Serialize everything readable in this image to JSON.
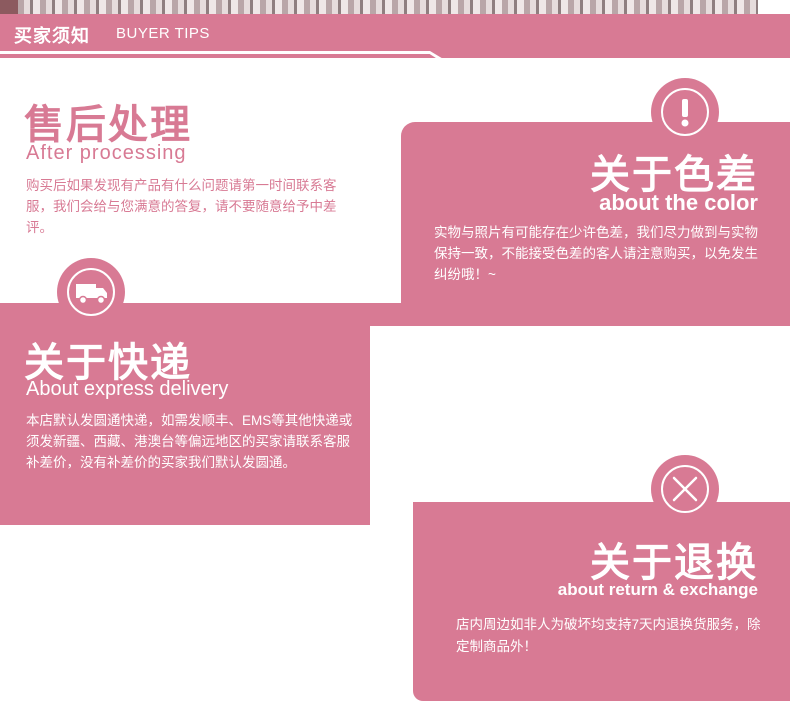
{
  "header": {
    "title_cn": "买家须知",
    "title_en": "BUYER TIPS"
  },
  "after": {
    "title_cn": "售后处理",
    "title_en": "After processing",
    "body": "购买后如果发现有产品有什么问题请第一时间联系客服，我们会给与您满意的答复，请不要随意给予中差评。"
  },
  "color": {
    "title_cn": "关于色差",
    "title_en": "about the color",
    "body": "实物与照片有可能存在少许色差，我们尽力做到与实物保持一致，不能接受色差的客人请注意购买，以免发生纠纷哦！~",
    "icon": "exclamation-icon"
  },
  "express": {
    "title_cn": "关于快递",
    "title_en": "About express delivery",
    "body": "本店默认发圆通快递，如需发顺丰、EMS等其他快递或须发新疆、西藏、港澳台等偏远地区的买家请联系客服补差价，没有补差价的买家我们默认发圆通。",
    "icon": "truck-icon"
  },
  "return": {
    "title_cn": "关于退换",
    "title_en": "about return & exchange",
    "body": "店内周边如非人为破坏均支持7天内退换货服务，除定制商品外！",
    "icon": "cross-icon"
  },
  "colors": {
    "accent": "#d87a94",
    "background": "#ffffff"
  }
}
